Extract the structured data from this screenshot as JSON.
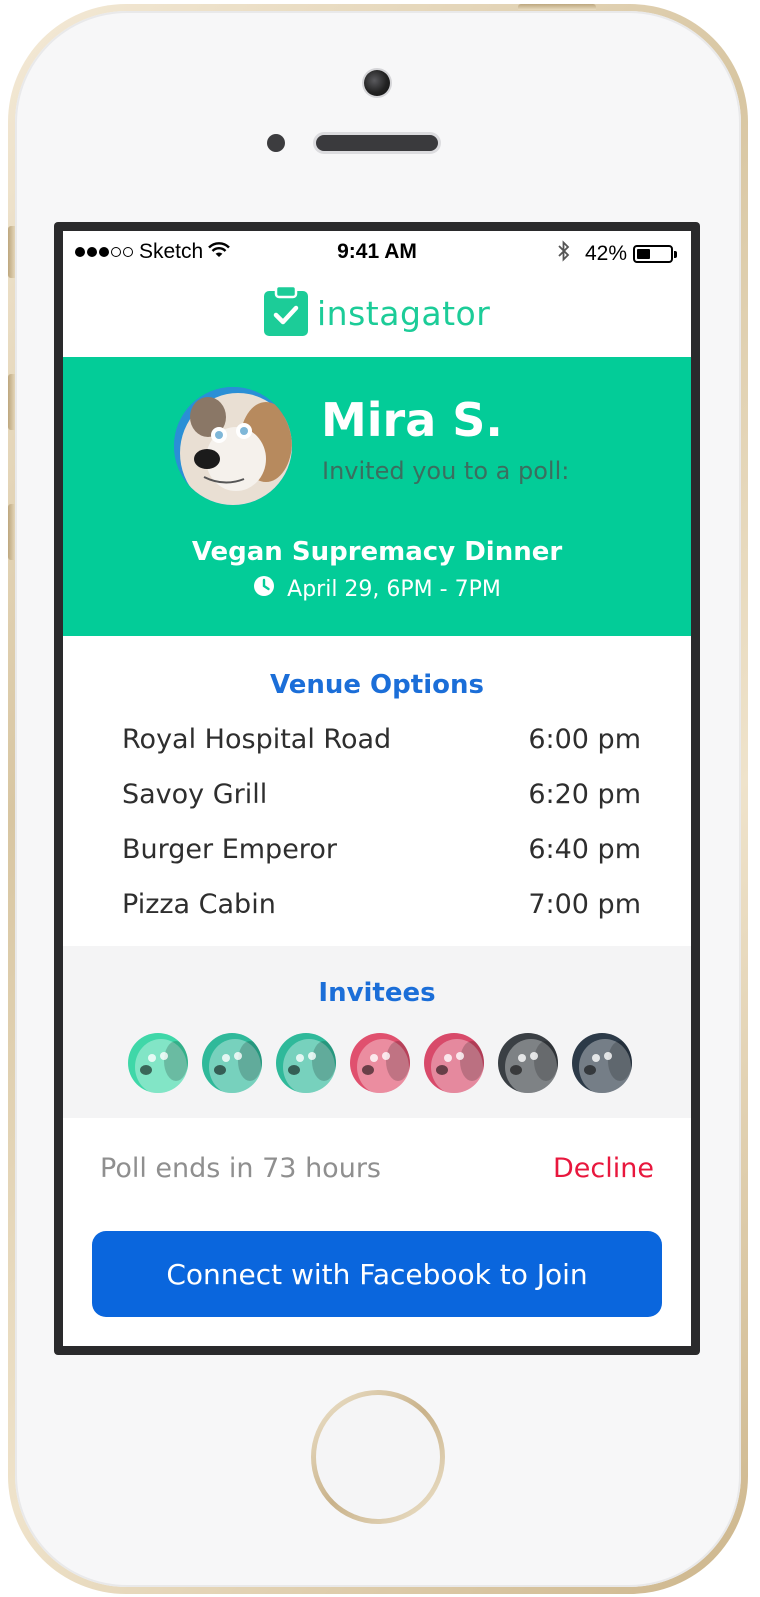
{
  "status_bar": {
    "carrier": "Sketch",
    "time": "9:41 AM",
    "battery_percent": "42%",
    "battery_level": 0.42,
    "signal_bars_filled": 3,
    "signal_bars_total": 5
  },
  "app": {
    "name": "instagator",
    "brand_color": "#1ccc98"
  },
  "invitation": {
    "host_name": "Mira S.",
    "invite_text": "Invited you to a poll:",
    "event_title": "Vegan Supremacy Dinner",
    "event_time": "April 29, 6PM - 7PM",
    "banner_color": "#03cc98"
  },
  "venues": {
    "title": "Venue Options",
    "items": [
      {
        "name": "Royal Hospital Road",
        "time": "6:00 pm"
      },
      {
        "name": "Savoy Grill",
        "time": "6:20 pm"
      },
      {
        "name": "Burger Emperor",
        "time": "6:40 pm"
      },
      {
        "name": "Pizza Cabin",
        "time": "7:00 pm"
      }
    ]
  },
  "invitees": {
    "title": "Invitees",
    "avatars": [
      {
        "tint": "#3fd7a8"
      },
      {
        "tint": "#2fb99a"
      },
      {
        "tint": "#2fb99a"
      },
      {
        "tint": "#e0506e"
      },
      {
        "tint": "#d84a6a"
      },
      {
        "tint": "#3a3f44"
      },
      {
        "tint": "#2c3a48"
      }
    ]
  },
  "footer": {
    "poll_ends": "Poll ends in 73 hours",
    "decline_label": "Decline",
    "join_button_label": "Connect with Facebook to Join",
    "accent_color": "#0a66dd",
    "decline_color": "#e8173d"
  }
}
